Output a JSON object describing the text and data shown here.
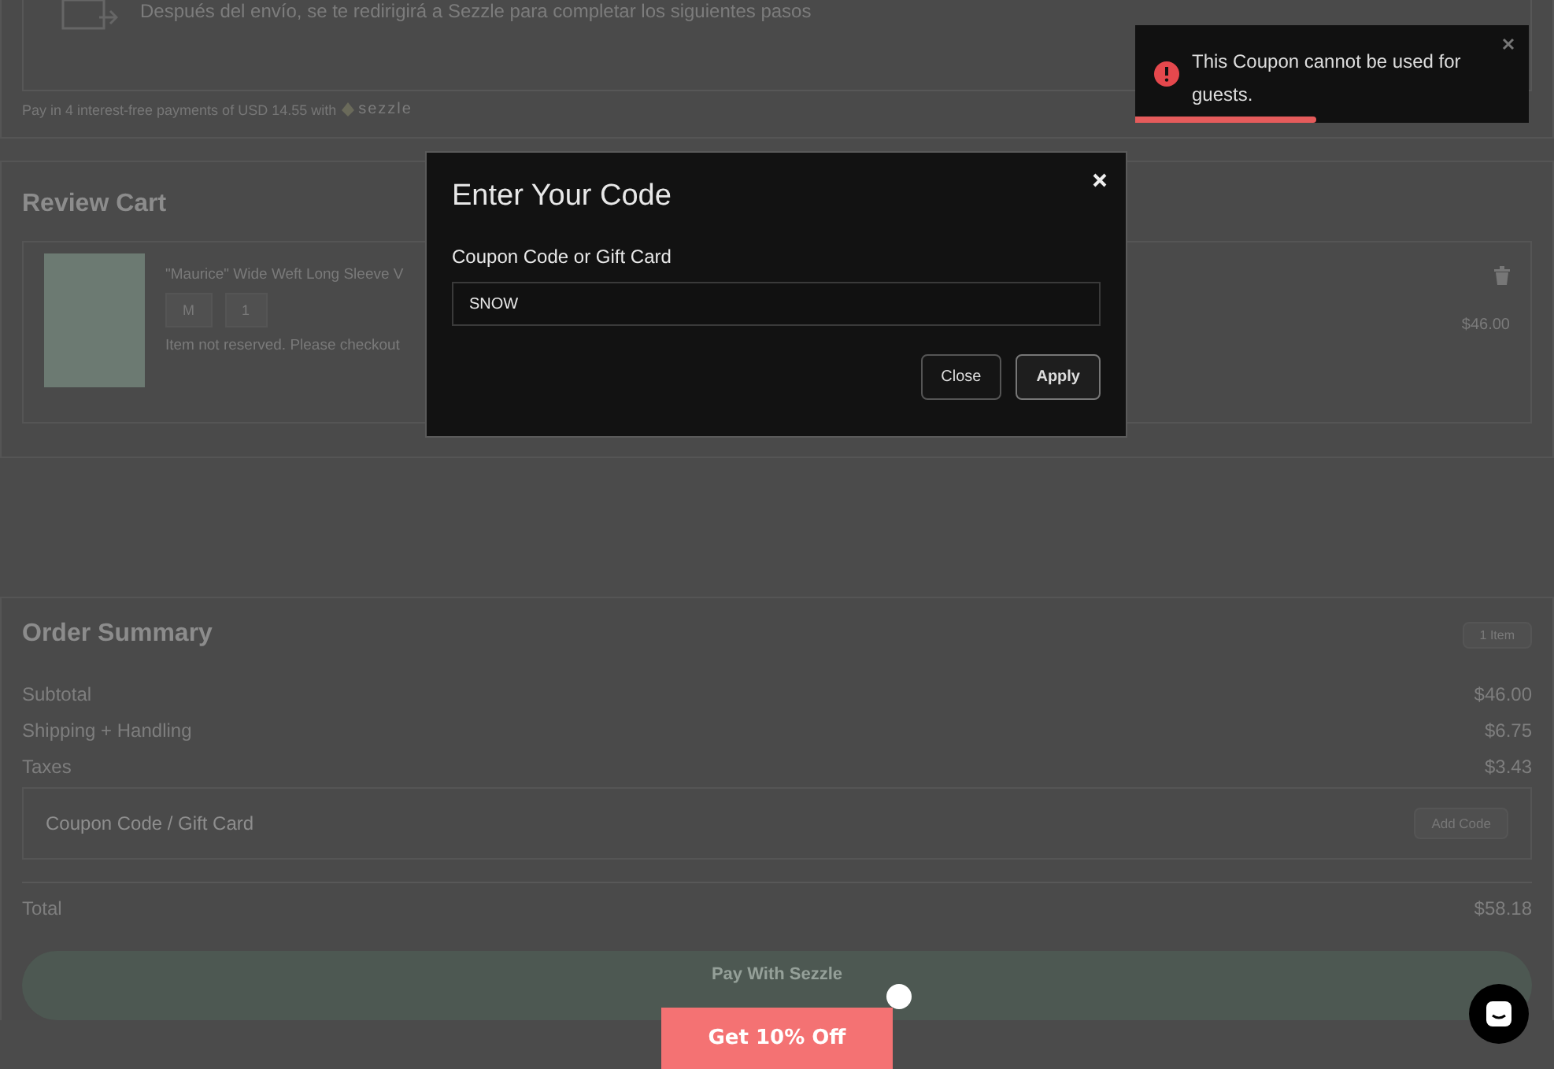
{
  "shipping_notice": {
    "text": "Después del envío, se te redirigirá a Sezzle para completar los siguientes pasos"
  },
  "installments": {
    "text": "Pay in 4 interest-free payments of USD 14.55 with",
    "brand": "sezzle"
  },
  "review_cart": {
    "title": "Review Cart",
    "items": [
      {
        "name": "\"Maurice\" Wide Weft Long Sleeve V",
        "size": "M",
        "quantity": "1",
        "note": "Item not reserved. Please checkout",
        "price": "$46.00"
      }
    ]
  },
  "order_summary": {
    "title": "Order Summary",
    "count": "1 Item",
    "rows": [
      {
        "label": "Subtotal",
        "value": "$46.00"
      },
      {
        "label": "Shipping + Handling",
        "value": "$6.75"
      },
      {
        "label": "Taxes",
        "value": "$3.43"
      }
    ],
    "coupon": {
      "placeholder": "Coupon Code / Gift Card",
      "button": "Add Code"
    },
    "total": {
      "label": "Total",
      "value": "$58.18"
    },
    "pay_button": "Pay With Sezzle"
  },
  "modal": {
    "title": "Enter Your Code",
    "field_label": "Coupon Code or Gift Card",
    "value": "SNOW",
    "buttons": [
      "Close",
      "Apply"
    ]
  },
  "toast": {
    "message": "This Coupon cannot be used for guests.",
    "level": 0.46
  },
  "promo": {
    "label": "Get 10% Off"
  }
}
